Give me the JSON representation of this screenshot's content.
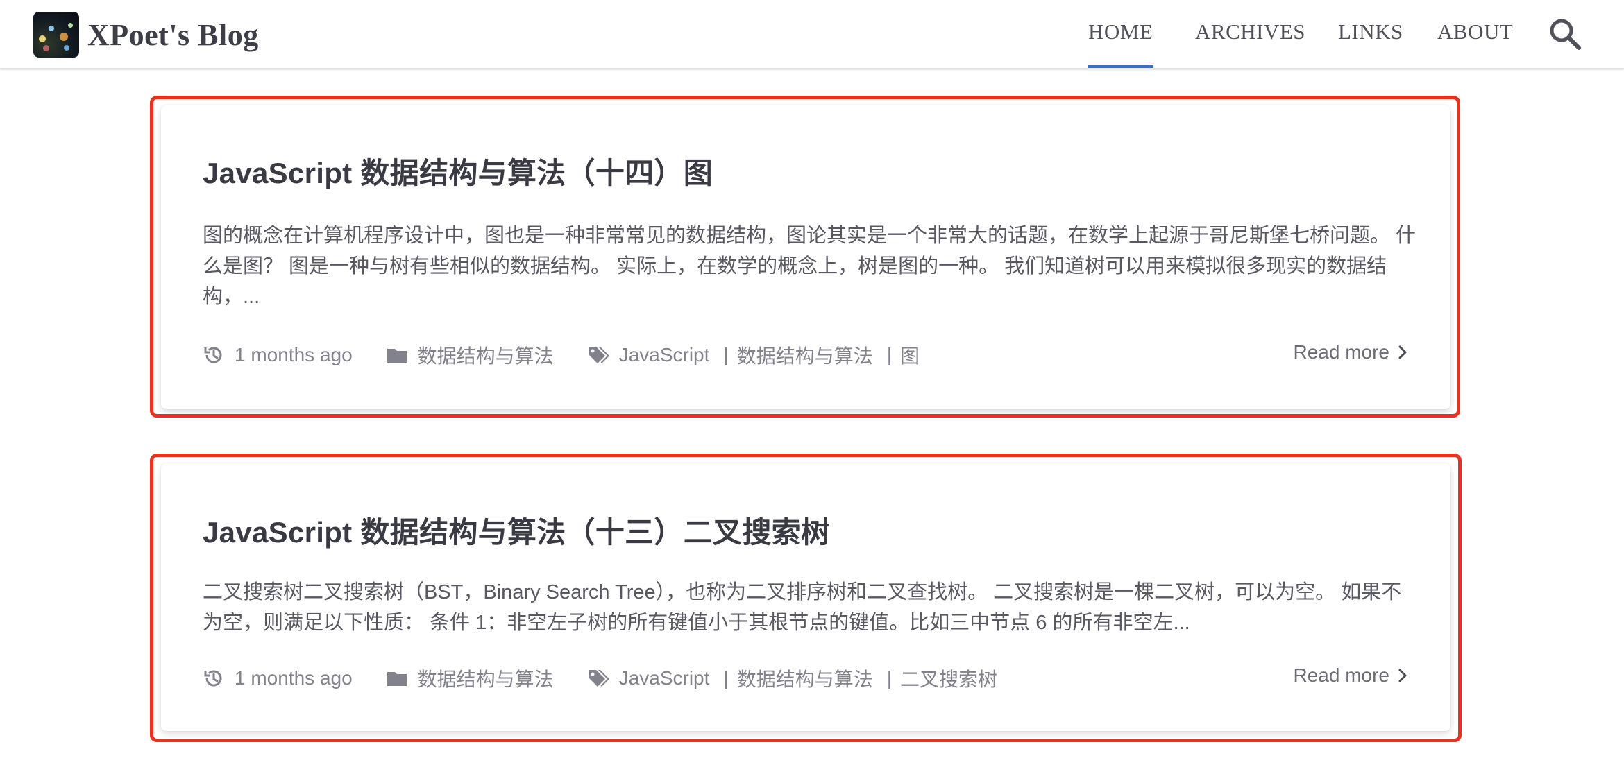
{
  "header": {
    "site_title": "XPoet's Blog",
    "nav": [
      {
        "label": "HOME",
        "active": true
      },
      {
        "label": "ARCHIVES",
        "active": false
      },
      {
        "label": "LINKS",
        "active": false
      },
      {
        "label": "ABOUT",
        "active": false
      }
    ],
    "search_icon": "search-icon",
    "active_color": "#3a6ec8"
  },
  "highlight_color": "#e8321f",
  "posts": [
    {
      "title": "JavaScript 数据结构与算法（十四）图",
      "excerpt": "图的概念在计算机程序设计中，图也是一种非常常见的数据结构，图论其实是一个非常大的话题，在数学上起源于哥尼斯堡七桥问题。 什么是图？ 图是一种与树有些相似的数据结构。 实际上，在数学的概念上，树是图的一种。 我们知道树可以用来模拟很多现实的数据结构，...",
      "date": "1 months ago",
      "category": "数据结构与算法",
      "tags": [
        "JavaScript",
        "数据结构与算法",
        "图"
      ],
      "read_more": "Read more"
    },
    {
      "title": "JavaScript 数据结构与算法（十三）二叉搜索树",
      "excerpt": "二叉搜索树二叉搜索树（BST，Binary Search Tree），也称为二叉排序树和二叉查找树。 二叉搜索树是一棵二叉树，可以为空。 如果不为空，则满足以下性质： 条件 1：非空左子树的所有键值小于其根节点的键值。比如三中节点 6 的所有非空左...",
      "date": "1 months ago",
      "category": "数据结构与算法",
      "tags": [
        "JavaScript",
        "数据结构与算法",
        "二叉搜索树"
      ],
      "read_more": "Read more"
    }
  ]
}
